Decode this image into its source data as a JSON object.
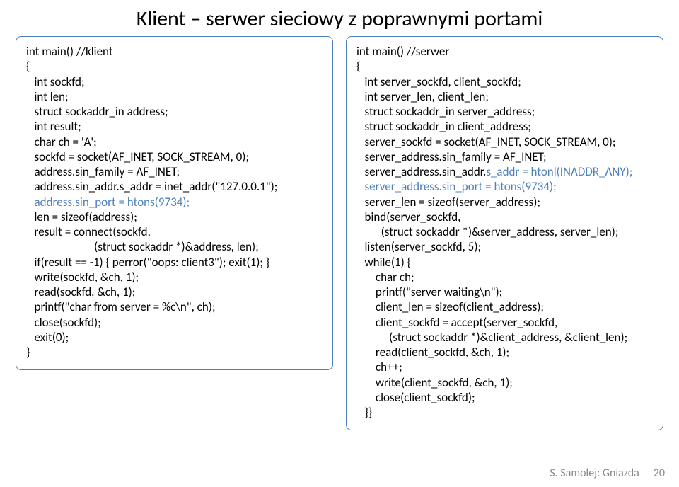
{
  "title": "Klient – serwer sieciowy z poprawnymi portami",
  "left": {
    "l1": "int main() //klient",
    "l2": "{",
    "l3": "   int sockfd;",
    "l4": "   int len;",
    "l5": "   struct sockaddr_in address;",
    "l6": "   int result;",
    "l7": "   char ch = 'A';",
    "l8": "   sockfd = socket(AF_INET, SOCK_STREAM, 0);",
    "l9": "   address.sin_family = AF_INET;",
    "l10": "   address.sin_addr.s_addr = inet_addr(\"127.0.0.1\");",
    "l11": "   address.sin_port = htons(9734);",
    "l12": "   len = sizeof(address);",
    "l13": "   result = connect(sockfd,",
    "l14": "                         (struct sockaddr *)&address, len);",
    "l15": "   if(result == -1) { perror(\"oops: client3\"); exit(1); }",
    "l16": "   write(sockfd, &ch, 1);",
    "l17": "   read(sockfd, &ch, 1);",
    "l18": "   printf(\"char from server = %c\\n\", ch);",
    "l19": "   close(sockfd);",
    "l20": "   exit(0);",
    "l21": "}"
  },
  "right": {
    "l1": "int main() //serwer",
    "l2": "{",
    "l3": "   int server_sockfd, client_sockfd;",
    "l4": "   int server_len, client_len;",
    "l5": "   struct sockaddr_in server_address;",
    "l6": "   struct sockaddr_in client_address;",
    "l7": "   server_sockfd = socket(AF_INET, SOCK_STREAM, 0);",
    "l8": "   server_address.sin_family = AF_INET;",
    "l9a": "   server_address.sin_addr.",
    "l9b": "s_addr = htonl(INADDR_ANY);",
    "l10": "   server_address.sin_port = htons(9734);",
    "l11": "   server_len = sizeof(server_address);",
    "l12": "   bind(server_sockfd,",
    "l13": "         (struct sockaddr *)&server_address, server_len);",
    "l14": "   listen(server_sockfd, 5);",
    "l15": "   while(1) {",
    "l16": "       char ch;",
    "l17": "       printf(\"server waiting\\n\");",
    "l18": "       client_len = sizeof(client_address);",
    "l19": "       client_sockfd = accept(server_sockfd,",
    "l20": "            (struct sockaddr *)&client_address, &client_len);",
    "l21": "       read(client_sockfd, &ch, 1);",
    "l22": "       ch++;",
    "l23": "       write(client_sockfd, &ch, 1);",
    "l24": "       close(client_sockfd);",
    "l25": "   }}"
  },
  "footer": {
    "author": "S. Samolej: Gniazda",
    "page": "20"
  }
}
